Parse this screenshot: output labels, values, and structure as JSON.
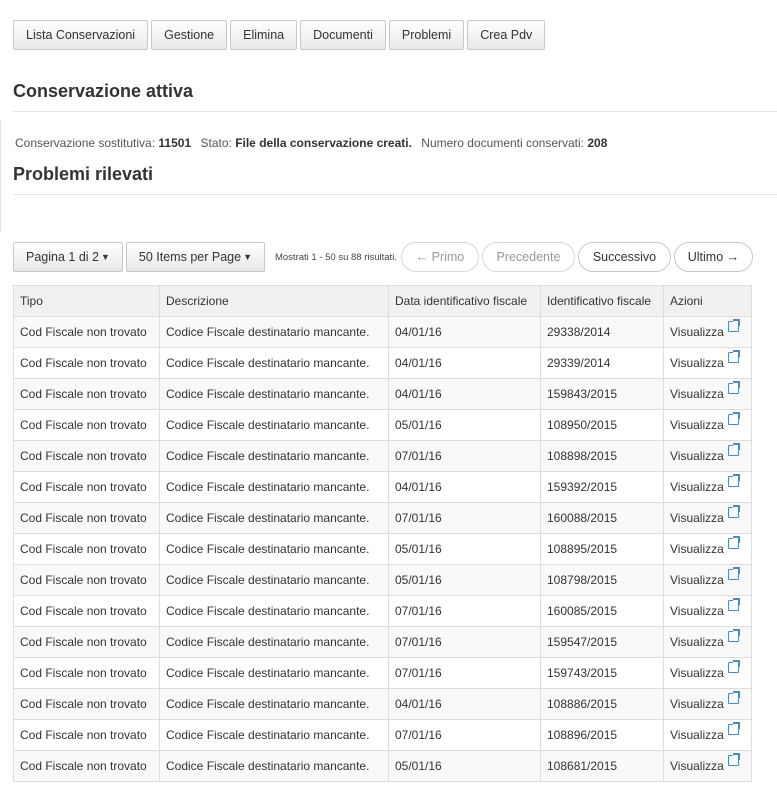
{
  "nav": {
    "buttons": [
      "Lista Conservazioni",
      "Gestione",
      "Elimina",
      "Documenti",
      "Problemi",
      "Crea Pdv"
    ]
  },
  "section_active": {
    "title": "Conservazione attiva"
  },
  "info": {
    "cons_label": "Conservazione sostitutiva:",
    "cons_value": "11501",
    "stato_label": "Stato:",
    "stato_value": "File della conservazione creati.",
    "num_label": "Numero documenti conservati:",
    "num_value": "208"
  },
  "section_problems": {
    "title": "Problemi rilevati"
  },
  "pager": {
    "page_label": "Pagina 1 di 2",
    "per_page_label": "50 Items per Page",
    "shown_text": "Mostrati 1 - 50 su 88 risultati.",
    "first": "← Primo",
    "prev": "Precedente",
    "next": "Successivo",
    "last": "Ultimo →"
  },
  "table": {
    "headers": [
      "Tipo",
      "Descrizione",
      "Data identificativo fiscale",
      "Identificativo fiscale",
      "Azioni"
    ],
    "rows": [
      [
        "Cod Fiscale non trovato",
        "Codice Fiscale destinatario mancante.",
        "04/01/16",
        "29338/2014",
        "Visualizza"
      ],
      [
        "Cod Fiscale non trovato",
        "Codice Fiscale destinatario mancante.",
        "04/01/16",
        "29339/2014",
        "Visualizza"
      ],
      [
        "Cod Fiscale non trovato",
        "Codice Fiscale destinatario mancante.",
        "04/01/16",
        "159843/2015",
        "Visualizza"
      ],
      [
        "Cod Fiscale non trovato",
        "Codice Fiscale destinatario mancante.",
        "05/01/16",
        "108950/2015",
        "Visualizza"
      ],
      [
        "Cod Fiscale non trovato",
        "Codice Fiscale destinatario mancante.",
        "07/01/16",
        "108898/2015",
        "Visualizza"
      ],
      [
        "Cod Fiscale non trovato",
        "Codice Fiscale destinatario mancante.",
        "04/01/16",
        "159392/2015",
        "Visualizza"
      ],
      [
        "Cod Fiscale non trovato",
        "Codice Fiscale destinatario mancante.",
        "07/01/16",
        "160088/2015",
        "Visualizza"
      ],
      [
        "Cod Fiscale non trovato",
        "Codice Fiscale destinatario mancante.",
        "05/01/16",
        "108895/2015",
        "Visualizza"
      ],
      [
        "Cod Fiscale non trovato",
        "Codice Fiscale destinatario mancante.",
        "05/01/16",
        "108798/2015",
        "Visualizza"
      ],
      [
        "Cod Fiscale non trovato",
        "Codice Fiscale destinatario mancante.",
        "07/01/16",
        "160085/2015",
        "Visualizza"
      ],
      [
        "Cod Fiscale non trovato",
        "Codice Fiscale destinatario mancante.",
        "07/01/16",
        "159547/2015",
        "Visualizza"
      ],
      [
        "Cod Fiscale non trovato",
        "Codice Fiscale destinatario mancante.",
        "07/01/16",
        "159743/2015",
        "Visualizza"
      ],
      [
        "Cod Fiscale non trovato",
        "Codice Fiscale destinatario mancante.",
        "04/01/16",
        "108886/2015",
        "Visualizza"
      ],
      [
        "Cod Fiscale non trovato",
        "Codice Fiscale destinatario mancante.",
        "07/01/16",
        "108896/2015",
        "Visualizza"
      ],
      [
        "Cod Fiscale non trovato",
        "Codice Fiscale destinatario mancante.",
        "05/01/16",
        "108681/2015",
        "Visualizza"
      ]
    ]
  },
  "icons": {
    "action_icon": "external-link-icon"
  },
  "colors": {
    "link_icon": "#4a8bc2",
    "header_bg": "#f1f1f1",
    "border": "#dddddd"
  }
}
